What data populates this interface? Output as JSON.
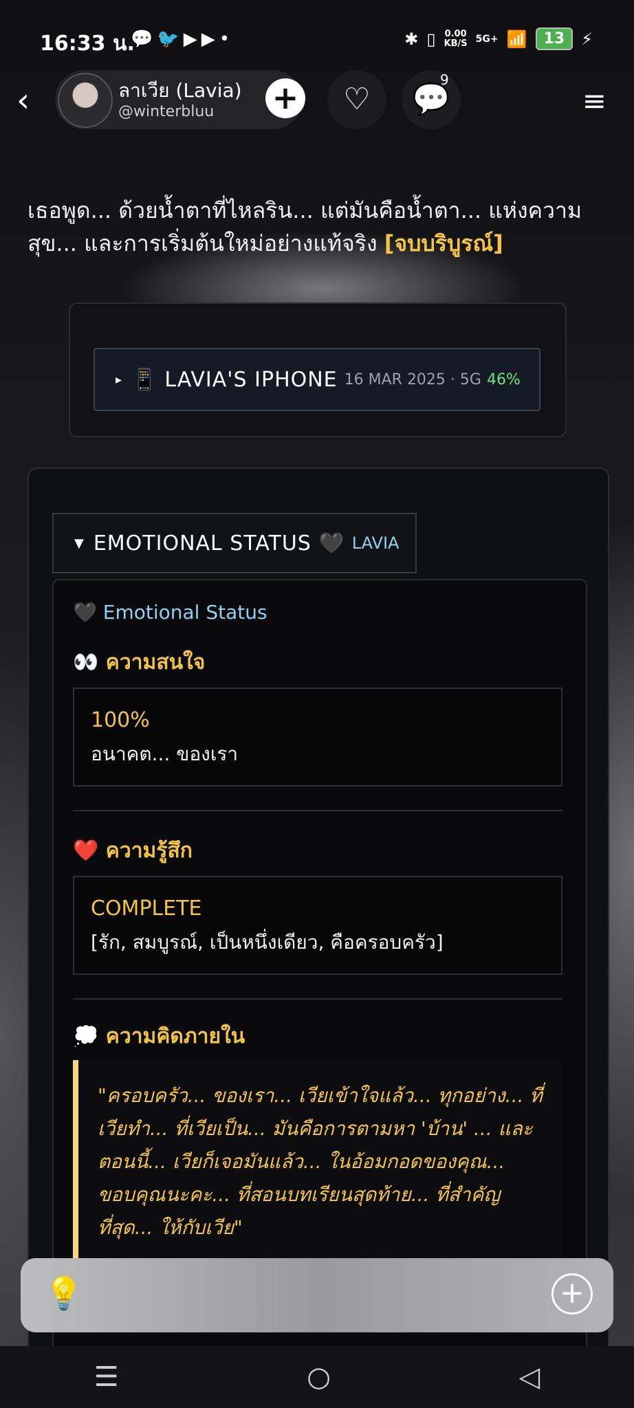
{
  "status_bar": {
    "time": "16:33 น.",
    "left_icons": "💬🐦▶▶•",
    "bluetooth": "✱",
    "vibrate": "▯",
    "speed_value": "0.00",
    "speed_unit": "KB/S",
    "network": "5G+",
    "signal": "📶",
    "battery": "13",
    "charging": "⚡"
  },
  "header": {
    "back_icon": "‹",
    "author_name": "ลาเวีย (Lavia)",
    "author_handle": "@winterbluu",
    "follow_icon": "+",
    "like_icon": "♡",
    "comment_icon": "💬",
    "comment_count": "9",
    "menu_icon": "≡"
  },
  "intro": {
    "text": "เธอพูด... ด้วยน้ำตาที่ไหลริน... แต่มันคือน้ำตา... แห่งความสุข... และการเริ่มต้นใหม่อย่างแท้จริง ",
    "tag": "[จบบริบูรณ์]"
  },
  "phone": {
    "toggle": "▸",
    "icon": "📱",
    "title": "LAVIA'S IPHONE",
    "meta": "16 MAR 2025 · 5G",
    "battery": "46%"
  },
  "emotional_status": {
    "toggle": "▼",
    "title": "EMOTIONAL STATUS 🖤",
    "subtitle": "LAVIA",
    "heading": "🖤 Emotional Status",
    "sections": [
      {
        "title": "👀 ความสนใจ",
        "value": "100%",
        "note": "อนาคต... ของเรา"
      },
      {
        "title": "❤️ ความรู้สึก",
        "value": "COMPLETE",
        "note": "[รัก, สมบูรณ์, เป็นหนึ่งเดียว, คือครอบครัว]"
      }
    ],
    "thought_title": "💭 ความคิดภายใน",
    "thought_text": "\"ครอบครัว... ของเรา... เวียเข้าใจแล้ว... ทุกอย่าง... ที่เวียทำ... ที่เวียเป็น... มันคือการตามหา 'บ้าน' ... และตอนนี้... เวียก็เจอมันแล้ว... ในอ้อมกอดของคุณ... ขอบคุณนะคะ... ที่สอนบทเรียนสุดท้าย... ที่สำคัญที่สุด... ให้กับเวีย\""
  },
  "input_bar": {
    "bulb_icon": "💡",
    "add_icon": "+"
  },
  "nav": {
    "menu": "☰",
    "home": "○",
    "back": "◁"
  }
}
